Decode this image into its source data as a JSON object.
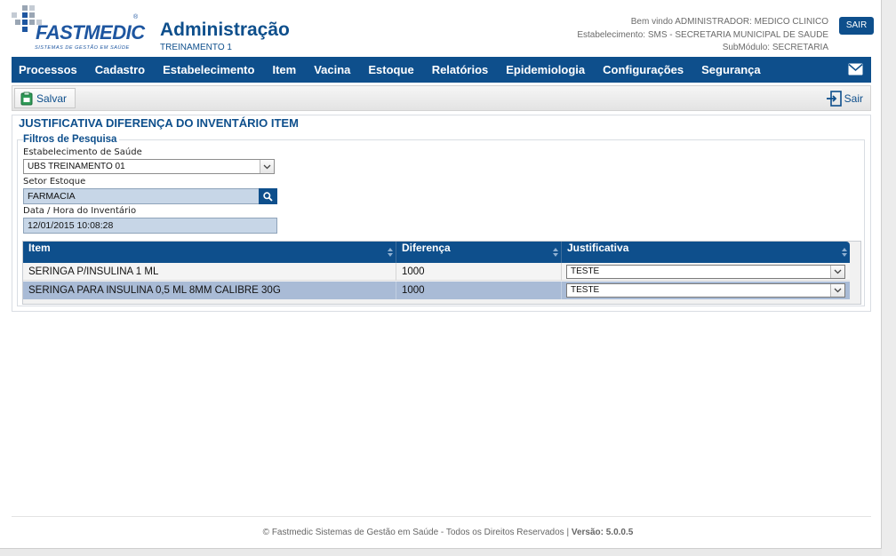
{
  "header": {
    "logo_text": "FASTMEDIC",
    "logo_tagline": "SISTEMAS DE GESTÃO EM SAÚDE",
    "logo_reg": "®",
    "title": "Administração",
    "subtitle": "TREINAMENTO 1",
    "welcome": "Bem vindo ADMINISTRADOR: MEDICO CLINICO",
    "establishment": "Estabelecimento: SMS - SECRETARIA MUNICIPAL DE SAUDE",
    "submodule": "SubMódulo: SECRETARIA",
    "logout_label": "SAIR"
  },
  "menu": {
    "items": [
      "Processos",
      "Cadastro",
      "Estabelecimento",
      "Item",
      "Vacina",
      "Estoque",
      "Relatórios",
      "Epidemiologia",
      "Configurações",
      "Segurança"
    ],
    "mail_icon": "envelope-icon"
  },
  "toolbar": {
    "save_label": "Salvar",
    "exit_label": "Sair"
  },
  "panel": {
    "title": "JUSTIFICATIVA DIFERENÇA DO INVENTÁRIO ITEM",
    "filters_legend": "Filtros de Pesquisa",
    "establishment_label": "Estabelecimento de Saúde",
    "establishment_value": "UBS TREINAMENTO 01",
    "sector_label": "Setor Estoque",
    "sector_value": "FARMACIA",
    "datetime_label": "Data / Hora do Inventário",
    "datetime_value": "12/01/2015 10:08:28"
  },
  "table": {
    "columns": [
      "Item",
      "Diferença",
      "Justificativa"
    ],
    "rows": [
      {
        "item": "SERINGA P/INSULINA 1 ML",
        "diff": "1000",
        "justification": "TESTE"
      },
      {
        "item": "SERINGA PARA INSULINA 0,5 ML 8MM CALIBRE 30G",
        "diff": "1000",
        "justification": "TESTE"
      }
    ]
  },
  "footer": {
    "copyright": "© Fastmedic Sistemas de Gestão em Saúde - Todos os Direitos Reservados | ",
    "version": "Versão: 5.0.0.5"
  },
  "colors": {
    "primary": "#0e4f8c",
    "selected_row": "#a9bbd6",
    "readonly_field": "#c7d6e7"
  }
}
